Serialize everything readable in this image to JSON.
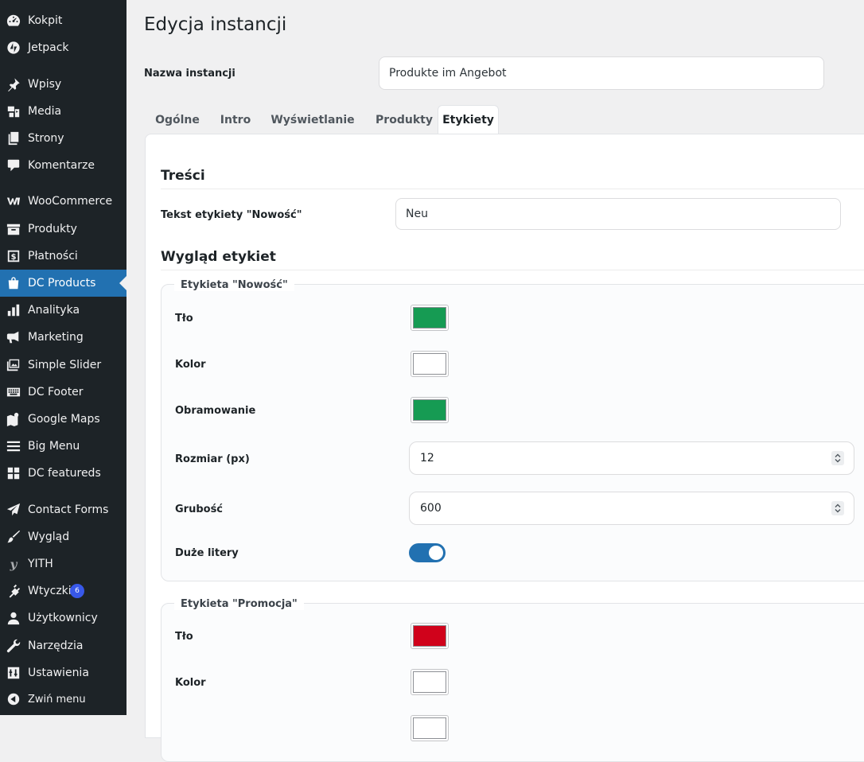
{
  "sidebar": {
    "items": [
      {
        "label": "Kokpit",
        "icon": "dashboard-icon"
      },
      {
        "label": "Jetpack",
        "icon": "jetpack-icon"
      },
      {
        "label": "Wpisy",
        "icon": "pin-icon"
      },
      {
        "label": "Media",
        "icon": "media-icon"
      },
      {
        "label": "Strony",
        "icon": "pages-icon"
      },
      {
        "label": "Komentarze",
        "icon": "comment-icon"
      },
      {
        "label": "WooCommerce",
        "icon": "woocommerce-icon"
      },
      {
        "label": "Produkty",
        "icon": "archive-icon"
      },
      {
        "label": "Płatności",
        "icon": "payments-icon"
      },
      {
        "label": "DC Products",
        "icon": "shopping-bag-icon",
        "active": true
      },
      {
        "label": "Analityka",
        "icon": "chart-bar-icon"
      },
      {
        "label": "Marketing",
        "icon": "megaphone-icon"
      },
      {
        "label": "Simple Slider",
        "icon": "images-icon"
      },
      {
        "label": "DC Footer",
        "icon": "keyboard-icon"
      },
      {
        "label": "Google Maps",
        "icon": "map-icon"
      },
      {
        "label": "Big Menu",
        "icon": "menu-icon"
      },
      {
        "label": "DC featureds",
        "icon": "grid-icon"
      },
      {
        "label": "Contact Forms",
        "icon": "email-icon"
      },
      {
        "label": "Wygląd",
        "icon": "brush-icon"
      },
      {
        "label": "YITH",
        "icon": "yith-icon"
      },
      {
        "label": "Wtyczki",
        "icon": "plugin-icon",
        "badge": "6"
      },
      {
        "label": "Użytkownicy",
        "icon": "users-icon"
      },
      {
        "label": "Narzędzia",
        "icon": "wrench-icon"
      },
      {
        "label": "Ustawienia",
        "icon": "settings-icon"
      }
    ],
    "collapse_label": "Zwiń menu"
  },
  "page": {
    "title": "Edycja instancji",
    "instance_name_label": "Nazwa instancji",
    "instance_name_value": "Produkte im Angebot"
  },
  "tabs": [
    "Ogólne",
    "Intro",
    "Wyświetlanie",
    "Produkty",
    "Etykiety"
  ],
  "active_tab": "Etykiety",
  "content_section": {
    "title": "Treści",
    "new_label_text_label": "Tekst etykiety \"Nowość\"",
    "new_label_text_value": "Neu"
  },
  "appearance_section": {
    "title": "Wygląd etykiet",
    "new_label": {
      "legend": "Etykieta \"Nowość\"",
      "bg_label": "Tło",
      "bg_color": "#169b53",
      "color_label": "Kolor",
      "text_color": "#ffffff",
      "border_label": "Obramowanie",
      "border_color": "#169b53",
      "size_label": "Rozmiar (px)",
      "size_value": "12",
      "weight_label": "Grubość",
      "weight_value": "600",
      "uppercase_label": "Duże litery",
      "uppercase": true
    },
    "promo_label": {
      "legend": "Etykieta \"Promocja\"",
      "bg_label": "Tło",
      "bg_color": "#d0021b",
      "color_label": "Kolor",
      "text_color": "#ffffff"
    }
  },
  "colors": {
    "sidebar_bg": "#1d2327",
    "accent": "#2271b1",
    "badge": "#3858e9"
  }
}
